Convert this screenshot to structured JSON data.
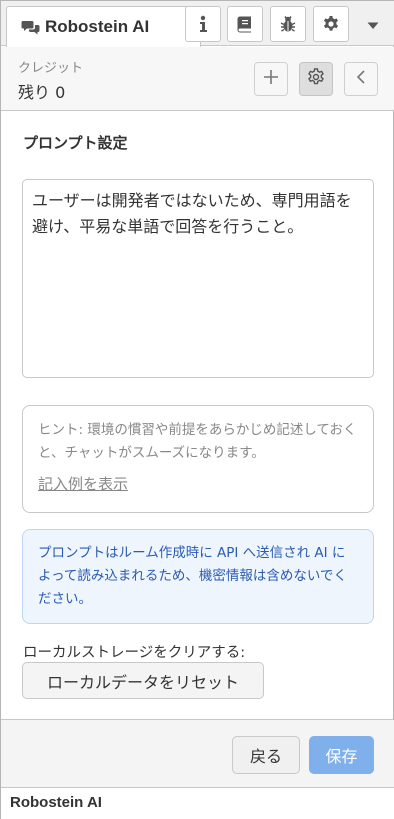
{
  "tabbar": {
    "title": "Robostein AI",
    "icons": [
      "chat-icon",
      "info-icon",
      "book-icon",
      "bug-icon",
      "gear-icon",
      "caret-down-icon"
    ]
  },
  "credit": {
    "label": "クレジット",
    "value": "残り 0",
    "icons": [
      "plus-icon",
      "gear-icon",
      "chevron-left-icon"
    ]
  },
  "prompt_settings": {
    "title": "プロンプト設定",
    "prompt_text": "ユーザーは開発者ではないため、専門用語を避け、平易な単語で回答を行うこと。",
    "hint": "ヒント: 環境の慣習や前提をあらかじめ記述しておくと、チャットがスムーズになります。",
    "example_link": "記入例を表示",
    "info": "プロンプトはルーム作成時に API へ送信され AI によって読み込まれるため、機密情報は含めないでください。",
    "clear_label": "ローカルストレージをクリアする:",
    "reset_button": "ローカルデータをリセット"
  },
  "footer": {
    "back_button": "戻る",
    "save_button": "保存",
    "brand": "Robostein AI"
  },
  "colors": {
    "save_button": "#7fb0ec",
    "info_text": "#2b5bb2",
    "info_bg": "#eef5fd"
  }
}
